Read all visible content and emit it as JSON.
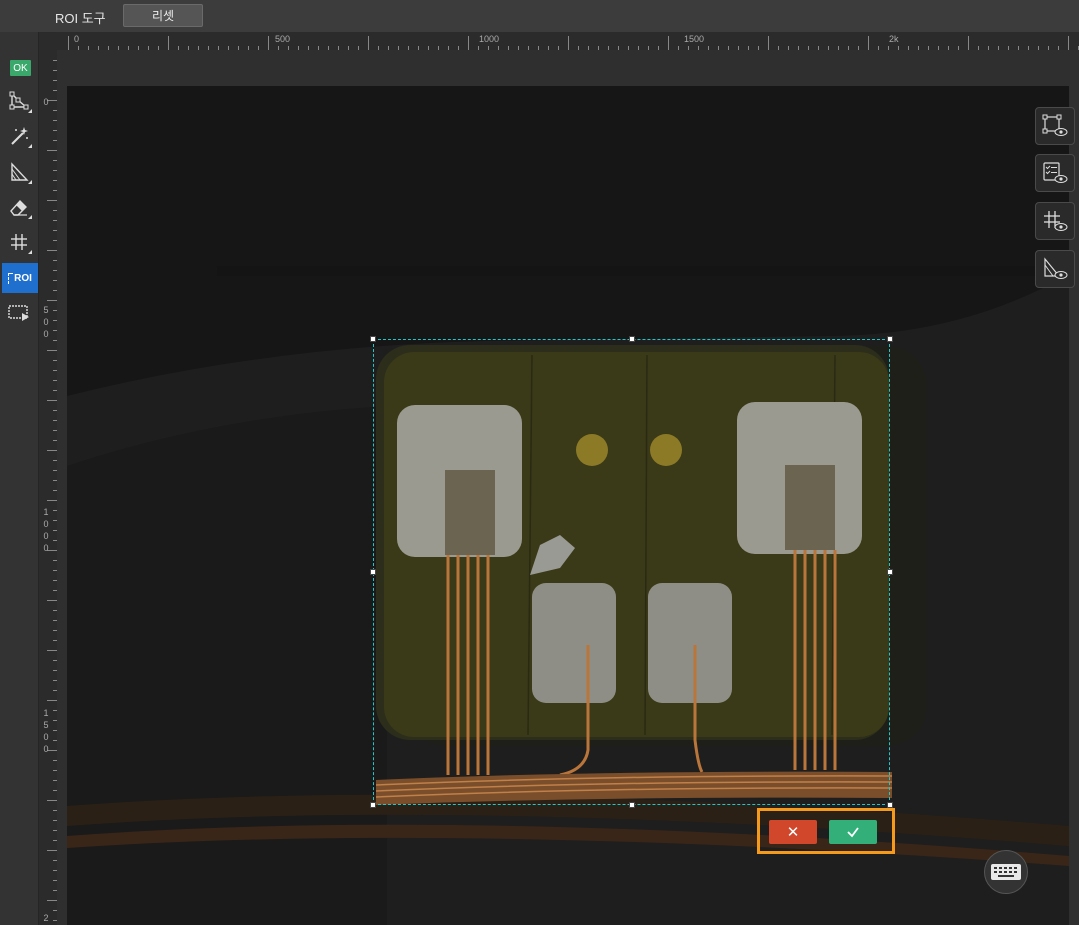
{
  "header": {
    "title": "ROI 도구",
    "reset_label": "리셋"
  },
  "toolbar": {
    "ok_label": "OK",
    "roi_label": "ROI",
    "tools": [
      "polygon-select-icon",
      "magic-wand-icon",
      "perspective-icon",
      "eraser-icon",
      "grid-icon",
      "roi-icon",
      "slideshow-icon"
    ]
  },
  "ruler": {
    "top_labels": [
      "0",
      "500",
      "1000",
      "1500",
      "2k"
    ],
    "left_labels": [
      "0",
      "5 0 0",
      "1 0 0 0",
      "1 5 0 0",
      "2"
    ]
  },
  "roi_actions": {
    "cancel_label": "✕",
    "confirm_icon": "check-icon"
  },
  "view_panel": [
    "roi-view-icon",
    "checklist-view-icon",
    "grid-view-icon",
    "perspective-view-icon"
  ],
  "keyboard": {
    "icon": "keyboard-icon"
  },
  "colors": {
    "accent_active": "#1f6fcf",
    "cancel": "#d0472c",
    "confirm": "#33b07a",
    "highlight": "#f59a1b",
    "roi_border": "#26c6c6"
  }
}
